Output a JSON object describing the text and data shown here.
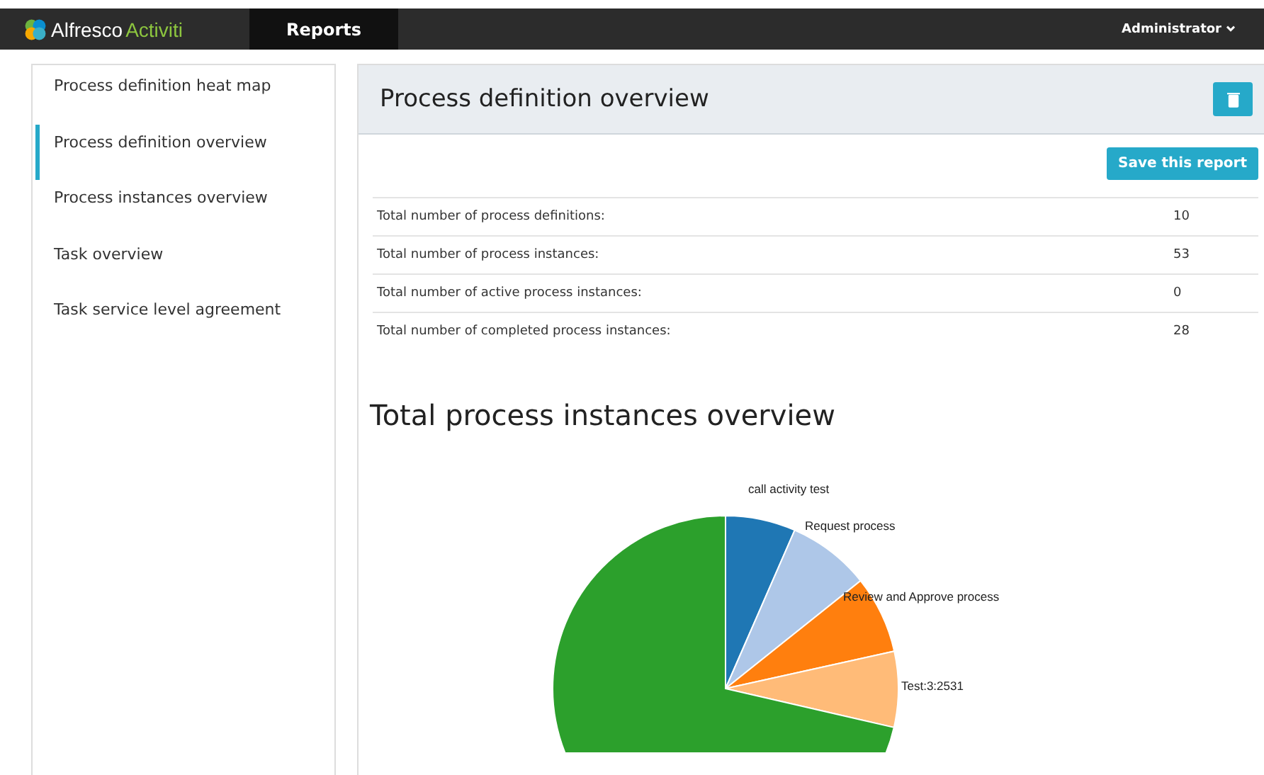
{
  "topbar": {
    "logo_text": "Alfresco",
    "logo_accent": "Activiti",
    "tabs": [
      {
        "label": "Reports",
        "selected": true
      }
    ],
    "user": "Administrator"
  },
  "sidebar": {
    "items": [
      {
        "label": "Process definition heat map",
        "selected": false
      },
      {
        "label": "Process definition overview",
        "selected": true
      },
      {
        "label": "Process instances overview",
        "selected": false
      },
      {
        "label": "Task overview",
        "selected": false
      },
      {
        "label": "Task service level agreement",
        "selected": false
      }
    ]
  },
  "report": {
    "title": "Process definition overview",
    "save_button": "Save this report",
    "stats": [
      {
        "label": "Total number of process definitions:",
        "value": "10"
      },
      {
        "label": "Total number of process instances:",
        "value": "53"
      },
      {
        "label": "Total number of active process instances:",
        "value": "0"
      },
      {
        "label": "Total number of completed process instances:",
        "value": "28"
      }
    ],
    "chart_title": "Total process instances overview",
    "slices": [
      {
        "label": "call activity test",
        "color": "#1f77b4"
      },
      {
        "label": "Request process",
        "color": "#aec7e8"
      },
      {
        "label": "Review and Approve process",
        "color": "#ff7f0e"
      },
      {
        "label": "Test:3:2531",
        "color": "#ffbb78"
      },
      {
        "color": "#2ca02c"
      }
    ]
  }
}
